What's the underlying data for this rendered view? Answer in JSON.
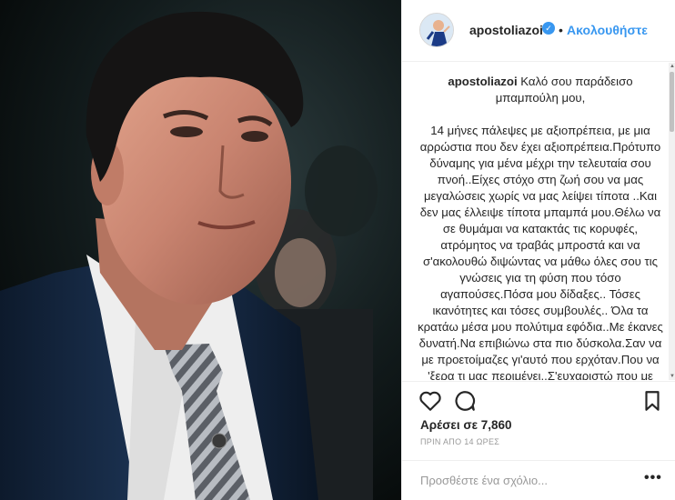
{
  "post": {
    "photo_alt": "man in suit and striped tie"
  },
  "header": {
    "username": "apostoliazoi",
    "verified_glyph": "✓",
    "separator": "•",
    "follow_label": "Ακολουθήστε",
    "avatar_icon": "avatar-icon"
  },
  "caption": {
    "username": "apostoliazoi",
    "paragraphs": [
      "Καλό σου παράδεισο μπαμπούλη μου,",
      "14 μήνες πάλεψες με αξιοπρέπεια, με μια αρρώστια που δεν έχει αξιοπρέπεια.Πρότυπο δύναμης για μένα μέχρι την τελευταία σου πνοή..Είχες στόχο στη ζωή σου να μας μεγαλώσεις χωρίς να μας λείψει τίποτα ..Και δεν μας έλλειψε τίποτα μπαμπά μου.Θέλω να σε θυμάμαι να κατακτάς τις κορυφές, ατρόμητος να τραβάς μπροστά και να σ'ακολουθώ διψώντας να μάθω όλες σου τις γνώσεις για τη φύση που τόσο αγαπούσες.Πόσα μου δίδαξες.. Τόσες ικανότητες και τόσες συμβουλές.. Όλα τα κρατάω μέσα μου πολύτιμα εφόδια..Με έκανες δυνατή.Να επιβιώνω στα πιο δύσκολα.Σαν να με προετοίμαζες γι'αυτό που ερχόταν.Που να 'ξερα τι μας περιμένει..Σ'ευχαριστώ που με"
    ]
  },
  "actions": {
    "like_icon": "heart-icon",
    "comment_icon": "comment-bubble-icon",
    "save_icon": "bookmark-icon",
    "likes_text": "Αρέσει σε 7,860",
    "time_text": "ΠΡΙΝ ΑΠΟ 14 ΩΡΕΣ"
  },
  "comment": {
    "placeholder": "Προσθέστε ένα σχόλιο...",
    "more_label": "•••"
  },
  "scrollbar": {
    "up_glyph": "▲",
    "down_glyph": "▼"
  }
}
